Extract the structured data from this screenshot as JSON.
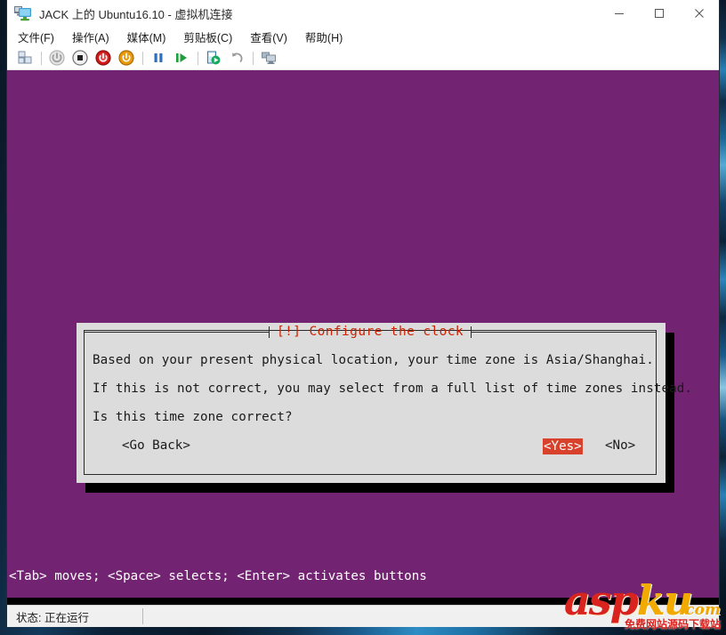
{
  "window": {
    "title": "JACK 上的 Ubuntu16.10 - 虚拟机连接",
    "icon": "virtual-machine-icon",
    "controls": {
      "minimize": "—",
      "maximize": "□",
      "close": "✕"
    }
  },
  "menubar": {
    "items": [
      {
        "label": "文件(F)",
        "name": "menu-file"
      },
      {
        "label": "操作(A)",
        "name": "menu-action"
      },
      {
        "label": "媒体(M)",
        "name": "menu-media"
      },
      {
        "label": "剪贴板(C)",
        "name": "menu-clipboard"
      },
      {
        "label": "查看(V)",
        "name": "menu-view"
      },
      {
        "label": "帮助(H)",
        "name": "menu-help"
      }
    ]
  },
  "toolbar": {
    "buttons": [
      {
        "name": "ctrl-alt-delete-icon",
        "title": "Ctrl+Alt+Delete"
      },
      {
        "name": "start-icon",
        "title": "启动"
      },
      {
        "name": "turn-off-icon",
        "title": "关闭"
      },
      {
        "name": "shut-down-icon",
        "title": "关机"
      },
      {
        "name": "save-state-icon",
        "title": "保存"
      },
      {
        "name": "pause-icon",
        "title": "暂停"
      },
      {
        "name": "resume-icon",
        "title": "继续"
      },
      {
        "name": "checkpoint-icon",
        "title": "检查点"
      },
      {
        "name": "revert-icon",
        "title": "还原"
      },
      {
        "name": "enhanced-session-icon",
        "title": "增强会话"
      }
    ]
  },
  "vm": {
    "background_color": "#722472",
    "dialog": {
      "title": "[!] Configure the clock",
      "title_color": "#cc2200",
      "lines": [
        "Based on your present physical location, your time zone is Asia/Shanghai.",
        "If this is not correct, you may select from a full list of time zones instead.",
        "Is this time zone correct?"
      ],
      "buttons": [
        {
          "label": "<Go Back>",
          "name": "go-back-button",
          "selected": false
        },
        {
          "label": "<Yes>",
          "name": "yes-button",
          "selected": true
        },
        {
          "label": "<No>",
          "name": "no-button",
          "selected": false
        }
      ],
      "selected_color": "#d8412b"
    },
    "help_line": "<Tab> moves; <Space> selects; <Enter> activates buttons"
  },
  "statusbar": {
    "text": "状态: 正在运行"
  },
  "watermark": {
    "part1": "asp",
    "part2": "ku",
    "suffix": ".com",
    "subtitle": "免费网站源码下载站"
  }
}
